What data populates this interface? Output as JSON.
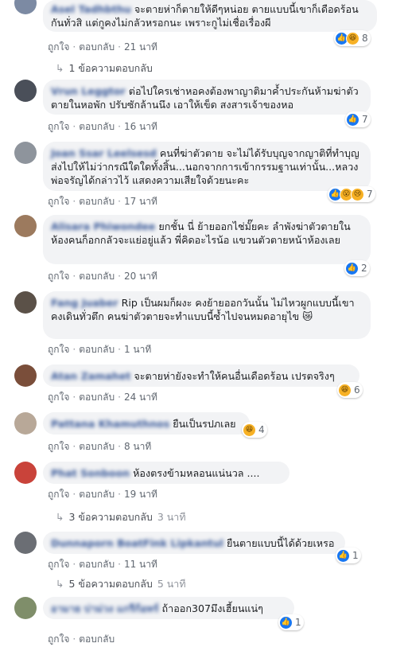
{
  "actions": {
    "like": "ถูกใจ",
    "reply": "ตอบกลับ"
  },
  "comments": [
    {
      "author": "Asel Tadhbthu",
      "text": "จะตายห่าก็ตายให้ดีๆหน่อย ตายแบบนี้เขาก็เดือดร้อนกันทั่วสิ แต่กูคงไม่กลัวหรอกนะ เพราะกูไม่เชื่อเรื่องผี",
      "time": "21 นาที",
      "reactions": [
        "like",
        "haha"
      ],
      "count": "8"
    },
    {
      "author": "Vrun Leggtor",
      "text": "ต่อไปใครเช่าหอคงต้องพาญาติมาค้ำประกันห้ามฆ่าตัวตายในหอพัก ปรับซักล้านนึง เอาให้เข็ด สงสารเจ้าของหอ",
      "time": "16 นาที",
      "reactions": [
        "like"
      ],
      "count": "7"
    },
    {
      "author": "Joan Ssar Leelsesd",
      "text": "คนที่ฆ่าตัวตาย จะไม่ได้รับบุญจากญาติที่ทำบุญส่งไปให้ไม่ว่ากรณีใดใดทั้งสิ้น...นอกจากการเข้ากรรมฐานเท่านั้น...หลวงพ่อจรัญได้กล่าวไว้ แสดงความเสียใจด้วยนะคะ",
      "time": "17 นาที",
      "reactions": [
        "like",
        "wow",
        "sad"
      ],
      "count": "7"
    },
    {
      "author": "Alisara Phiwondee",
      "text": "ยกชั้น นี่ ย้ายออกไช่มั๊ยคะ ลำพังฆ่าตัวตายในห้องคนก็อกกลัวจะแย่อยู่แล้ว พี่คิดอะไรน้อ แขวนตัวตายหน้าห้องเลย",
      "time": "20 นาที",
      "reactions": [
        "like"
      ],
      "count": "2"
    },
    {
      "author": "Fang Juaber",
      "text": "Rip เป็นผมก็ผงะ คงย้ายออกวันนั้น ไม่ไหวผูกแบบนี้เขาคงเดินทั่วตึก คนฆ่าตัวตายจะทำแบบนี้ซ้ำไปจนหมดอายุไข 😿",
      "time": "1 นาที",
      "reactions": [],
      "count": ""
    },
    {
      "author": "Atan Zamahet",
      "text": "จะตายห่ายังจะทำให้คนอื่นเดือดร้อน เปรตจริงๆ",
      "time": "24 นาที",
      "reactions": [
        "haha"
      ],
      "count": "6"
    },
    {
      "author": "Pattana Khamuthnos",
      "text": "ยืนเป็นรปภเลย",
      "time": "8 นาที",
      "reactions": [
        "haha"
      ],
      "count": "4"
    },
    {
      "author": "Phat Sonboon",
      "text": "ห้องตรงข้ามหลอนแน่นวล ....",
      "time": "19 นาที",
      "reactions": [],
      "count": ""
    },
    {
      "author": "Dunnaporn BoatFink Lipkantul",
      "text": "ยืนตายแบบนี้ได้ด้วยเหรอ",
      "time": "11 นาที",
      "reactions": [
        "like"
      ],
      "count": "1"
    },
    {
      "author": "อามาย บ่าม่วง แกรีก้อทร์",
      "text": "ถ้าออก307มึงเฮี้ยนแน่ๆ",
      "time": "",
      "reactions": [
        "like"
      ],
      "count": "1"
    }
  ],
  "reply_links": [
    {
      "label": "1 ข้อความตอบกลับ",
      "ago": ""
    },
    {
      "label": "3 ข้อความตอบกลับ",
      "ago": "3 นาที"
    },
    {
      "label": "5 ข้อความตอบกลับ",
      "ago": "5 นาที"
    }
  ],
  "colors": {
    "bubble": "#f2f3f5",
    "author": "#385898",
    "like": "#1877f2",
    "emoji": "#f7b125"
  }
}
